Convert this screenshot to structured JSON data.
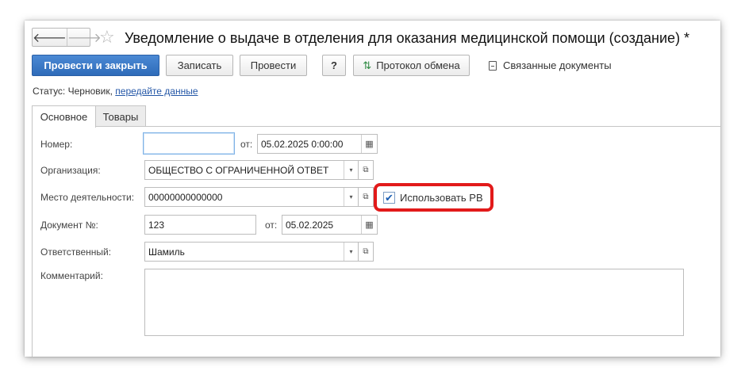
{
  "window": {
    "title": "Уведомление о выдаче в отделения для оказания медицинской помощи (создание) *",
    "nav": {
      "back_icon": "arrow-left-icon",
      "forward_icon": "arrow-right-icon",
      "back_glyph": "🡐",
      "forward_glyph": "🡒",
      "favorite_glyph": "☆"
    }
  },
  "toolbar": {
    "post_and_close": "Провести и закрыть",
    "save": "Записать",
    "post": "Провести",
    "help": "?",
    "exchange_protocol": "Протокол обмена",
    "related_documents": "Связанные документы",
    "exchange_icon_glyph": "⇅"
  },
  "status": {
    "label": "Статус:",
    "value": "Черновик,",
    "link": "передайте данные"
  },
  "tabs": [
    {
      "label": "Основное",
      "active": true
    },
    {
      "label": "Товары",
      "active": false
    }
  ],
  "form": {
    "number": {
      "label": "Номер:",
      "value": "",
      "from_label": "от:",
      "date": "05.02.2025  0:00:00"
    },
    "organization": {
      "label": "Организация:",
      "value": "ОБЩЕСТВО С ОГРАНИЧЕННОЙ ОТВЕТ"
    },
    "place": {
      "label": "Место деятельности:",
      "value": "00000000000000"
    },
    "use_rv": {
      "label": "Использовать РВ",
      "checked": true,
      "highlight_color": "#e21a1a"
    },
    "document": {
      "label": "Документ №:",
      "value": "123",
      "from_label": "от:",
      "date": "05.02.2025"
    },
    "responsible": {
      "label": "Ответственный:",
      "value": "Шамиль"
    },
    "comment": {
      "label": "Комментарий:",
      "value": ""
    }
  },
  "glyphs": {
    "dropdown": "▾",
    "open": "⧉",
    "calendar": "▦",
    "check": "✔"
  },
  "colors": {
    "primary": "#2e6bb9",
    "link": "#2457a7",
    "highlight": "#e21a1a"
  }
}
